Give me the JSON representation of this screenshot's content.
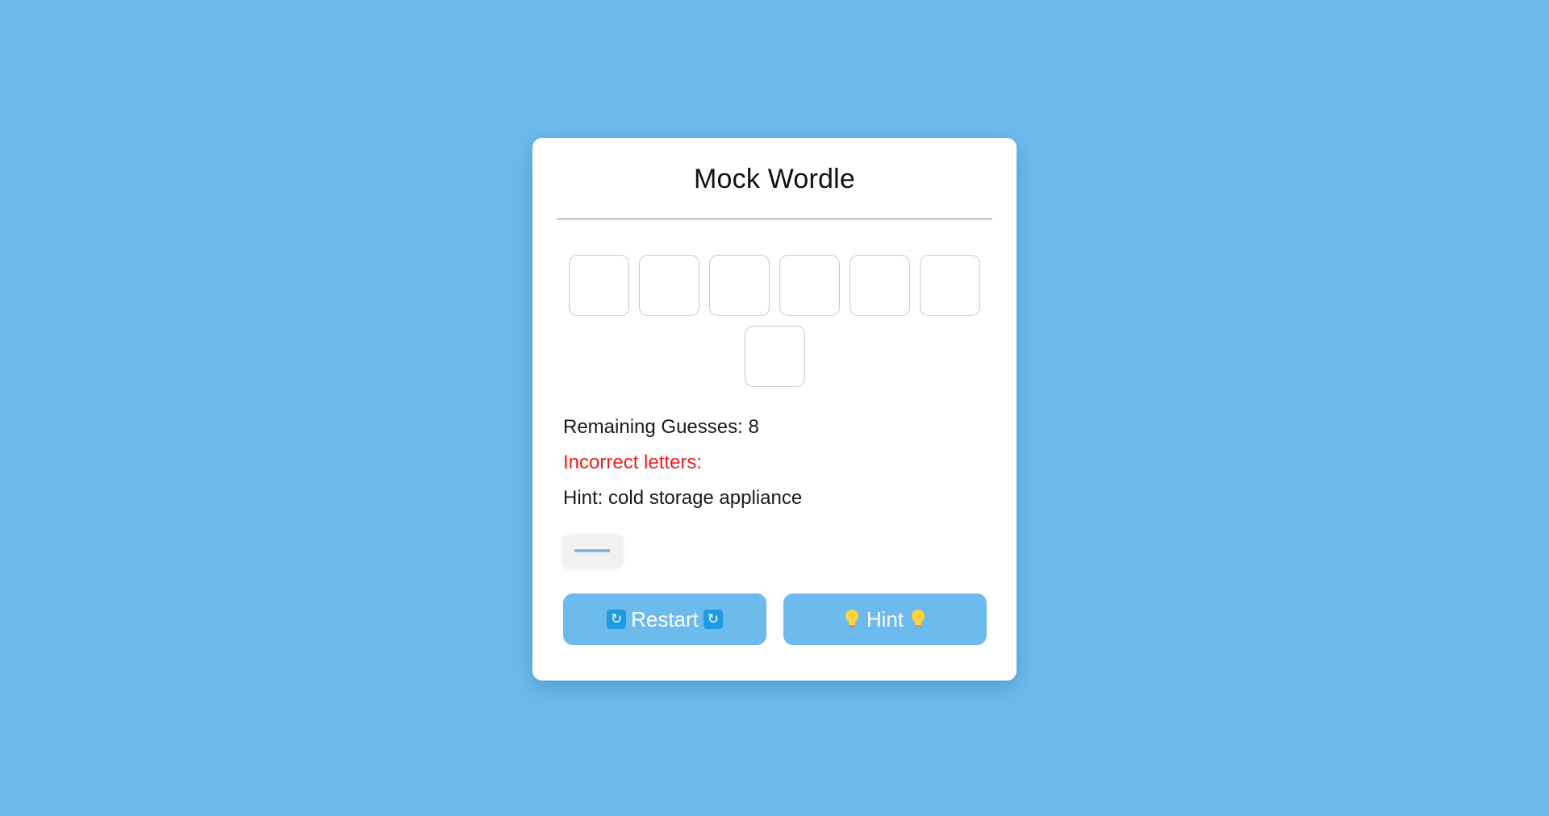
{
  "title": "Mock Wordle",
  "word_tiles": [
    "",
    "",
    "",
    "",
    "",
    "",
    ""
  ],
  "remaining_guesses": "Remaining Guesses: 8",
  "incorrect_letters": "Incorrect letters:",
  "hint": "Hint: cold storage appliance",
  "guess_input": {
    "value": "",
    "placeholder": ""
  },
  "buttons": {
    "restart_label": "Restart",
    "restart_icon": "counterclockwise-arrows-icon",
    "hint_label": "Hint",
    "hint_icon": "light-bulb-icon"
  },
  "colors": {
    "background": "#6cbbec",
    "card": "#ffffff",
    "incorrect_text": "#ee1c1c",
    "button": "#6cbbec"
  }
}
